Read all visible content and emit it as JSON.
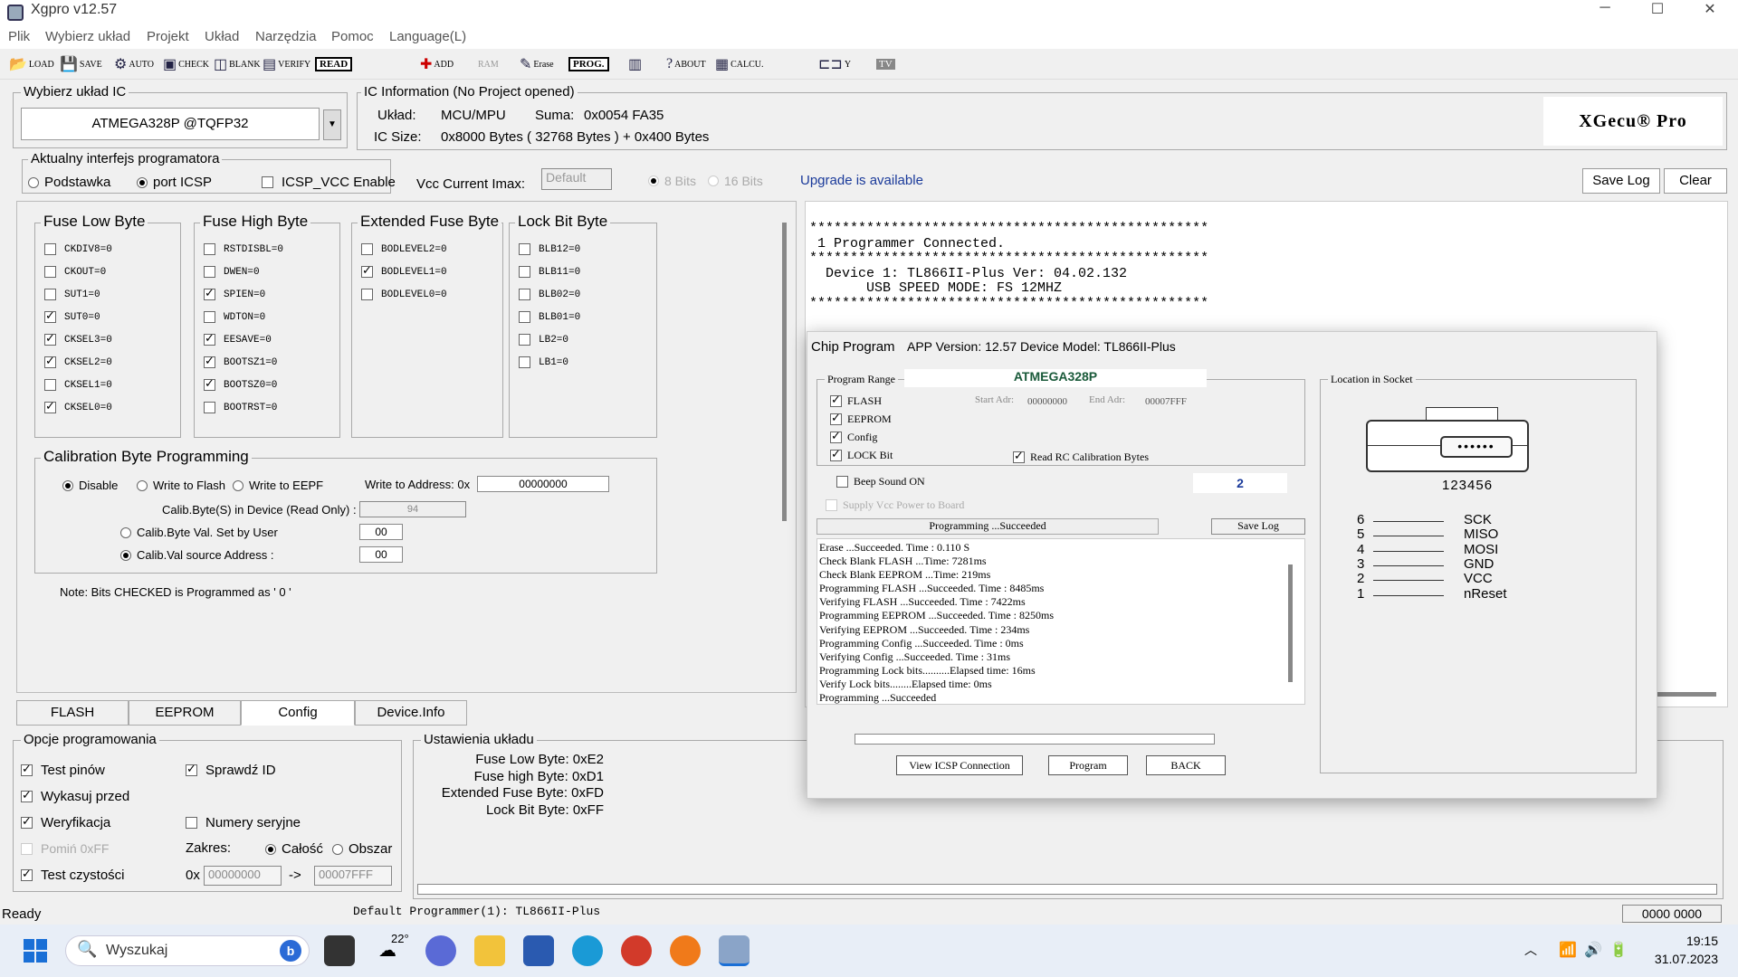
{
  "window": {
    "title": "Xgpro v12.57",
    "minimize": "─",
    "maximize": "☐",
    "close": "✕"
  },
  "menu": [
    "Plik",
    "Wybierz układ",
    "Projekt",
    "Układ",
    "Narzędzia",
    "Pomoc",
    "Language(L)"
  ],
  "toolbar": {
    "load": "LOAD",
    "save": "SAVE",
    "auto": "AUTO",
    "check": "CHECK",
    "blank": "BLANK",
    "verify": "VERIFY",
    "read": "READ",
    "add": "ADD",
    "ram": "RAM",
    "erase": "Erase",
    "prog": "PROG.",
    "about": "ABOUT",
    "calcu": "CALCU.",
    "y": "Y",
    "tv": "TV"
  },
  "ic_select": {
    "legend": "Wybierz układ IC",
    "value": "ATMEGA328P @TQFP32"
  },
  "ic_info": {
    "legend": "IC Information (No Project opened)",
    "uklad_label": "Układ:",
    "uklad_value": "MCU/MPU",
    "suma_label": "Suma:",
    "suma_value": "0x0054 FA35",
    "size_label": "IC Size:",
    "size_value": "0x8000 Bytes ( 32768 Bytes ) + 0x400 Bytes",
    "logo": "XGecu® Pro"
  },
  "interface": {
    "legend": "Aktualny interfejs programatora",
    "opt1": "Podstawka",
    "opt2": "port ICSP",
    "icsp_vcc": "ICSP_VCC Enable",
    "vcc_label": "Vcc Current Imax:",
    "vcc_value": "Default",
    "bits8": "8 Bits",
    "bits16": "16 Bits",
    "upgrade": "Upgrade is available",
    "save_log": "Save Log",
    "clear": "Clear"
  },
  "fuse_low": {
    "title": "Fuse Low Byte",
    "items": [
      {
        "l": "CKDIV8=0",
        "c": false
      },
      {
        "l": "CKOUT=0",
        "c": false
      },
      {
        "l": "SUT1=0",
        "c": false
      },
      {
        "l": "SUT0=0",
        "c": true
      },
      {
        "l": "CKSEL3=0",
        "c": true
      },
      {
        "l": "CKSEL2=0",
        "c": true
      },
      {
        "l": "CKSEL1=0",
        "c": false
      },
      {
        "l": "CKSEL0=0",
        "c": true
      }
    ]
  },
  "fuse_high": {
    "title": "Fuse High Byte",
    "items": [
      {
        "l": "RSTDISBL=0",
        "c": false
      },
      {
        "l": "DWEN=0",
        "c": false
      },
      {
        "l": "SPIEN=0",
        "c": true
      },
      {
        "l": "WDTON=0",
        "c": false
      },
      {
        "l": "EESAVE=0",
        "c": true
      },
      {
        "l": "BOOTSZ1=0",
        "c": true
      },
      {
        "l": "BOOTSZ0=0",
        "c": true
      },
      {
        "l": "BOOTRST=0",
        "c": false
      }
    ]
  },
  "fuse_ext": {
    "title": "Extended Fuse Byte",
    "items": [
      {
        "l": "BODLEVEL2=0",
        "c": false
      },
      {
        "l": "BODLEVEL1=0",
        "c": true
      },
      {
        "l": "BODLEVEL0=0",
        "c": false
      }
    ]
  },
  "lock": {
    "title": "Lock Bit Byte",
    "items": [
      {
        "l": "BLB12=0",
        "c": false
      },
      {
        "l": "BLB11=0",
        "c": false
      },
      {
        "l": "BLB02=0",
        "c": false
      },
      {
        "l": "BLB01=0",
        "c": false
      },
      {
        "l": "LB2=0",
        "c": false
      },
      {
        "l": "LB1=0",
        "c": false
      }
    ]
  },
  "calib": {
    "title": "Calibration Byte Programming",
    "disable": "Disable",
    "write_flash": "Write to Flash",
    "write_eep": "Write to EEPF",
    "addr_label": "Write to Address: 0x",
    "addr_value": "00000000",
    "read_label": "Calib.Byte(S) in Device (Read Only) :",
    "read_value": "94",
    "user_label": "Calib.Byte Val. Set by User",
    "user_value": "00",
    "src_label": "Calib.Val source Address :",
    "src_value": "00",
    "note": "Note: Bits CHECKED is Programmed as ' 0 '"
  },
  "tabs": [
    "FLASH",
    "EEPROM",
    "Config",
    "Device.Info"
  ],
  "log": {
    "text": "*************************************************\n 1 Programmer Connected.\n*************************************************\n  Device 1: TL866II-Plus Ver: 04.02.132\n       USB SPEED MODE: FS 12MHZ\n*************************************************"
  },
  "opts": {
    "legend": "Opcje programowania",
    "test_pinow": "Test pinów",
    "sprawdz_id": "Sprawdź ID",
    "wykasuj": "Wykasuj przed",
    "weryfikacja": "Weryfikacja",
    "numery": "Numery seryjne",
    "pomin": "Pomiń 0xFF",
    "zakres": "Zakres:",
    "calosc": "Całość",
    "obszar": "Obszar",
    "test_czystosci": "Test czystości",
    "ox": "0x",
    "from": "00000000",
    "arrow": "->",
    "to": "00007FFF"
  },
  "settings": {
    "legend": "Ustawienia układu",
    "l1": "Fuse Low Byte: 0xE2",
    "l2": "Fuse high Byte: 0xD1",
    "l3": "Extended Fuse Byte: 0xFD",
    "l4": "Lock Bit Byte: 0xFF"
  },
  "status": {
    "ready": "Ready",
    "programmer": "Default Programmer(1): TL866II-Plus",
    "code": "0000 0000"
  },
  "dialog": {
    "title": "Chip Program",
    "app": "APP Version: 12.57 Device Model: TL866II-Plus",
    "range": "Program Range",
    "chip": "ATMEGA328P",
    "flash": "FLASH",
    "start_label": "Start Adr:",
    "start": "00000000",
    "end_label": "End Adr:",
    "end": "00007FFF",
    "eeprom": "EEPROM",
    "config": "Config",
    "lockbit": "LOCK Bit",
    "read_rc": "Read RC Calibration Bytes",
    "beep": "Beep Sound ON",
    "count": "2",
    "supply": "Supply Vcc Power to Board",
    "status": "Programming ...Succeeded",
    "save_log": "Save Log",
    "log": [
      "Erase ...Succeeded. Time : 0.110 S",
      "Check Blank FLASH ...Time: 7281ms",
      "Check Blank EEPROM ...Time: 219ms",
      "Programming FLASH ...Succeeded. Time : 8485ms",
      "Verifying FLASH ...Succeeded. Time : 7422ms",
      "Programming EEPROM ...Succeeded. Time : 8250ms",
      "Verifying EEPROM ...Succeeded. Time : 234ms",
      "Programming Config ...Succeeded. Time : 0ms",
      "Verifying Config ...Succeeded. Time : 31ms",
      "Programming Lock bits..........Elapsed time: 16ms",
      "Verify Lock bits........Elapsed time: 0ms",
      "Programming ...Succeeded"
    ],
    "view_icsp": "View ICSP Connection",
    "program": "Program",
    "back": "BACK",
    "location": "Location in Socket",
    "pins_label": "123456",
    "pins": [
      {
        "n": "6",
        "s": "SCK"
      },
      {
        "n": "5",
        "s": "MISO"
      },
      {
        "n": "4",
        "s": "MOSI"
      },
      {
        "n": "3",
        "s": "GND"
      },
      {
        "n": "2",
        "s": "VCC"
      },
      {
        "n": "1",
        "s": "nReset"
      }
    ]
  },
  "taskbar": {
    "search": "Wyszukaj",
    "weather": "22°",
    "time": "19:15",
    "date": "31.07.2023"
  }
}
